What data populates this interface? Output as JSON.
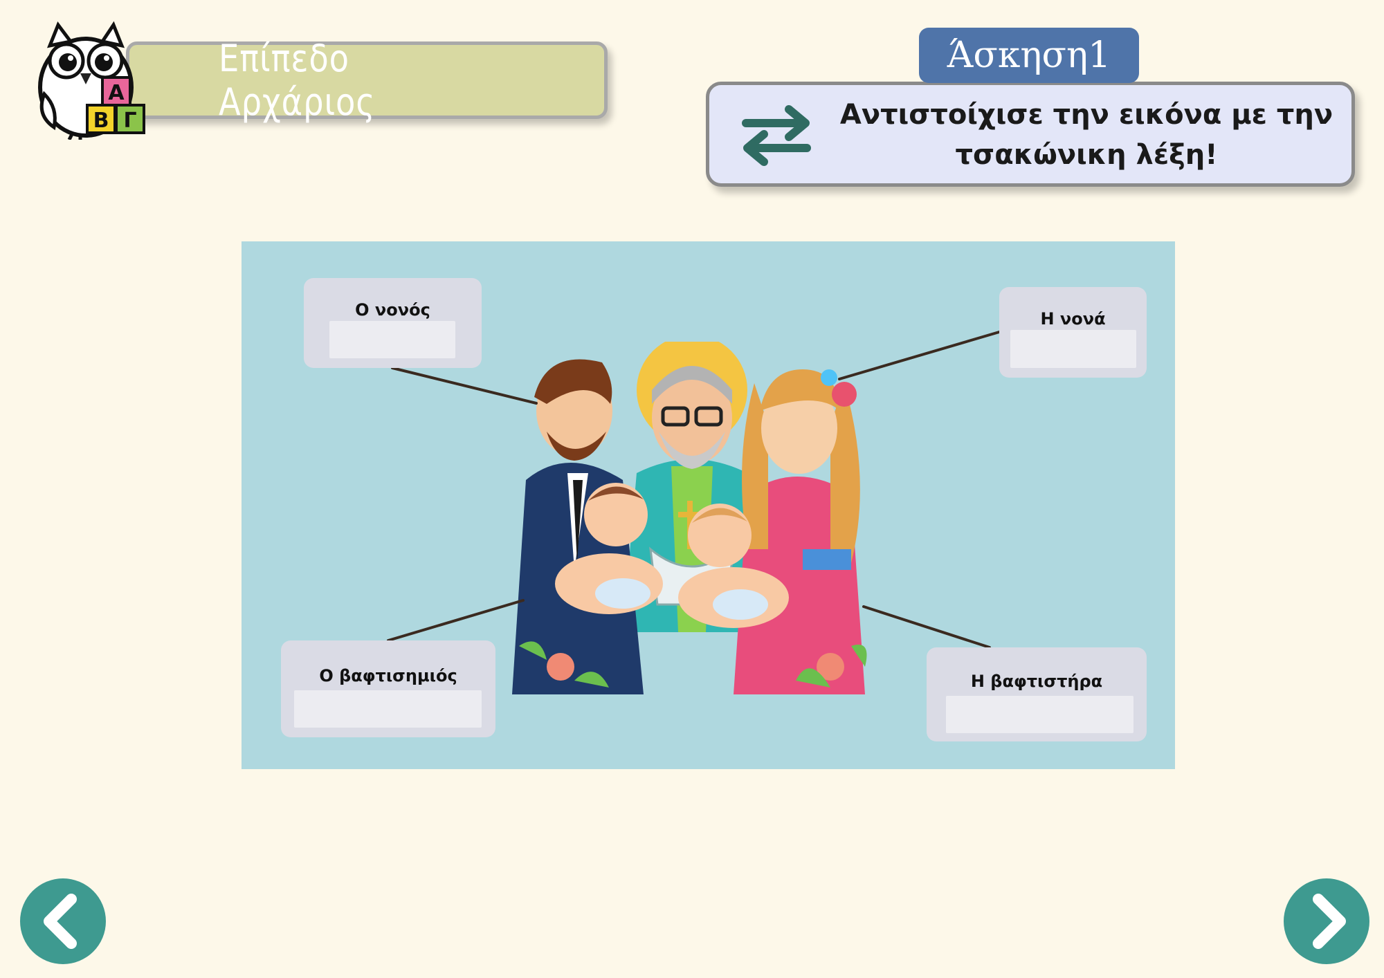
{
  "header": {
    "level_label": "Επίπεδο Αρχάριος",
    "logo_letters": [
      "Α",
      "Β",
      "Γ"
    ],
    "exercise_tag": "Άσκηση1",
    "instruction": "Αντιστοίχισε την εικόνα με την τσακώνικη λέξη!"
  },
  "activity": {
    "labels": {
      "godfather": "Ο νονός",
      "godmother": "Η νονά",
      "godson": "Ο βαφτισημιός",
      "goddaughter": "Η βαφτιστήρα"
    },
    "answers": {
      "godfather": "",
      "godmother": "",
      "godson": "",
      "goddaughter": ""
    }
  },
  "navigation": {
    "prev_icon": "chevron-left-icon",
    "next_icon": "chevron-right-icon"
  },
  "colors": {
    "background": "#fdf8e9",
    "panel": "#afd8df",
    "level_banner": "#d8d9a2",
    "exercise_tag": "#4f74a9",
    "instruction_box": "#e3e6f8",
    "nav_button": "#3e9a90",
    "connector": "#3a2a20"
  }
}
